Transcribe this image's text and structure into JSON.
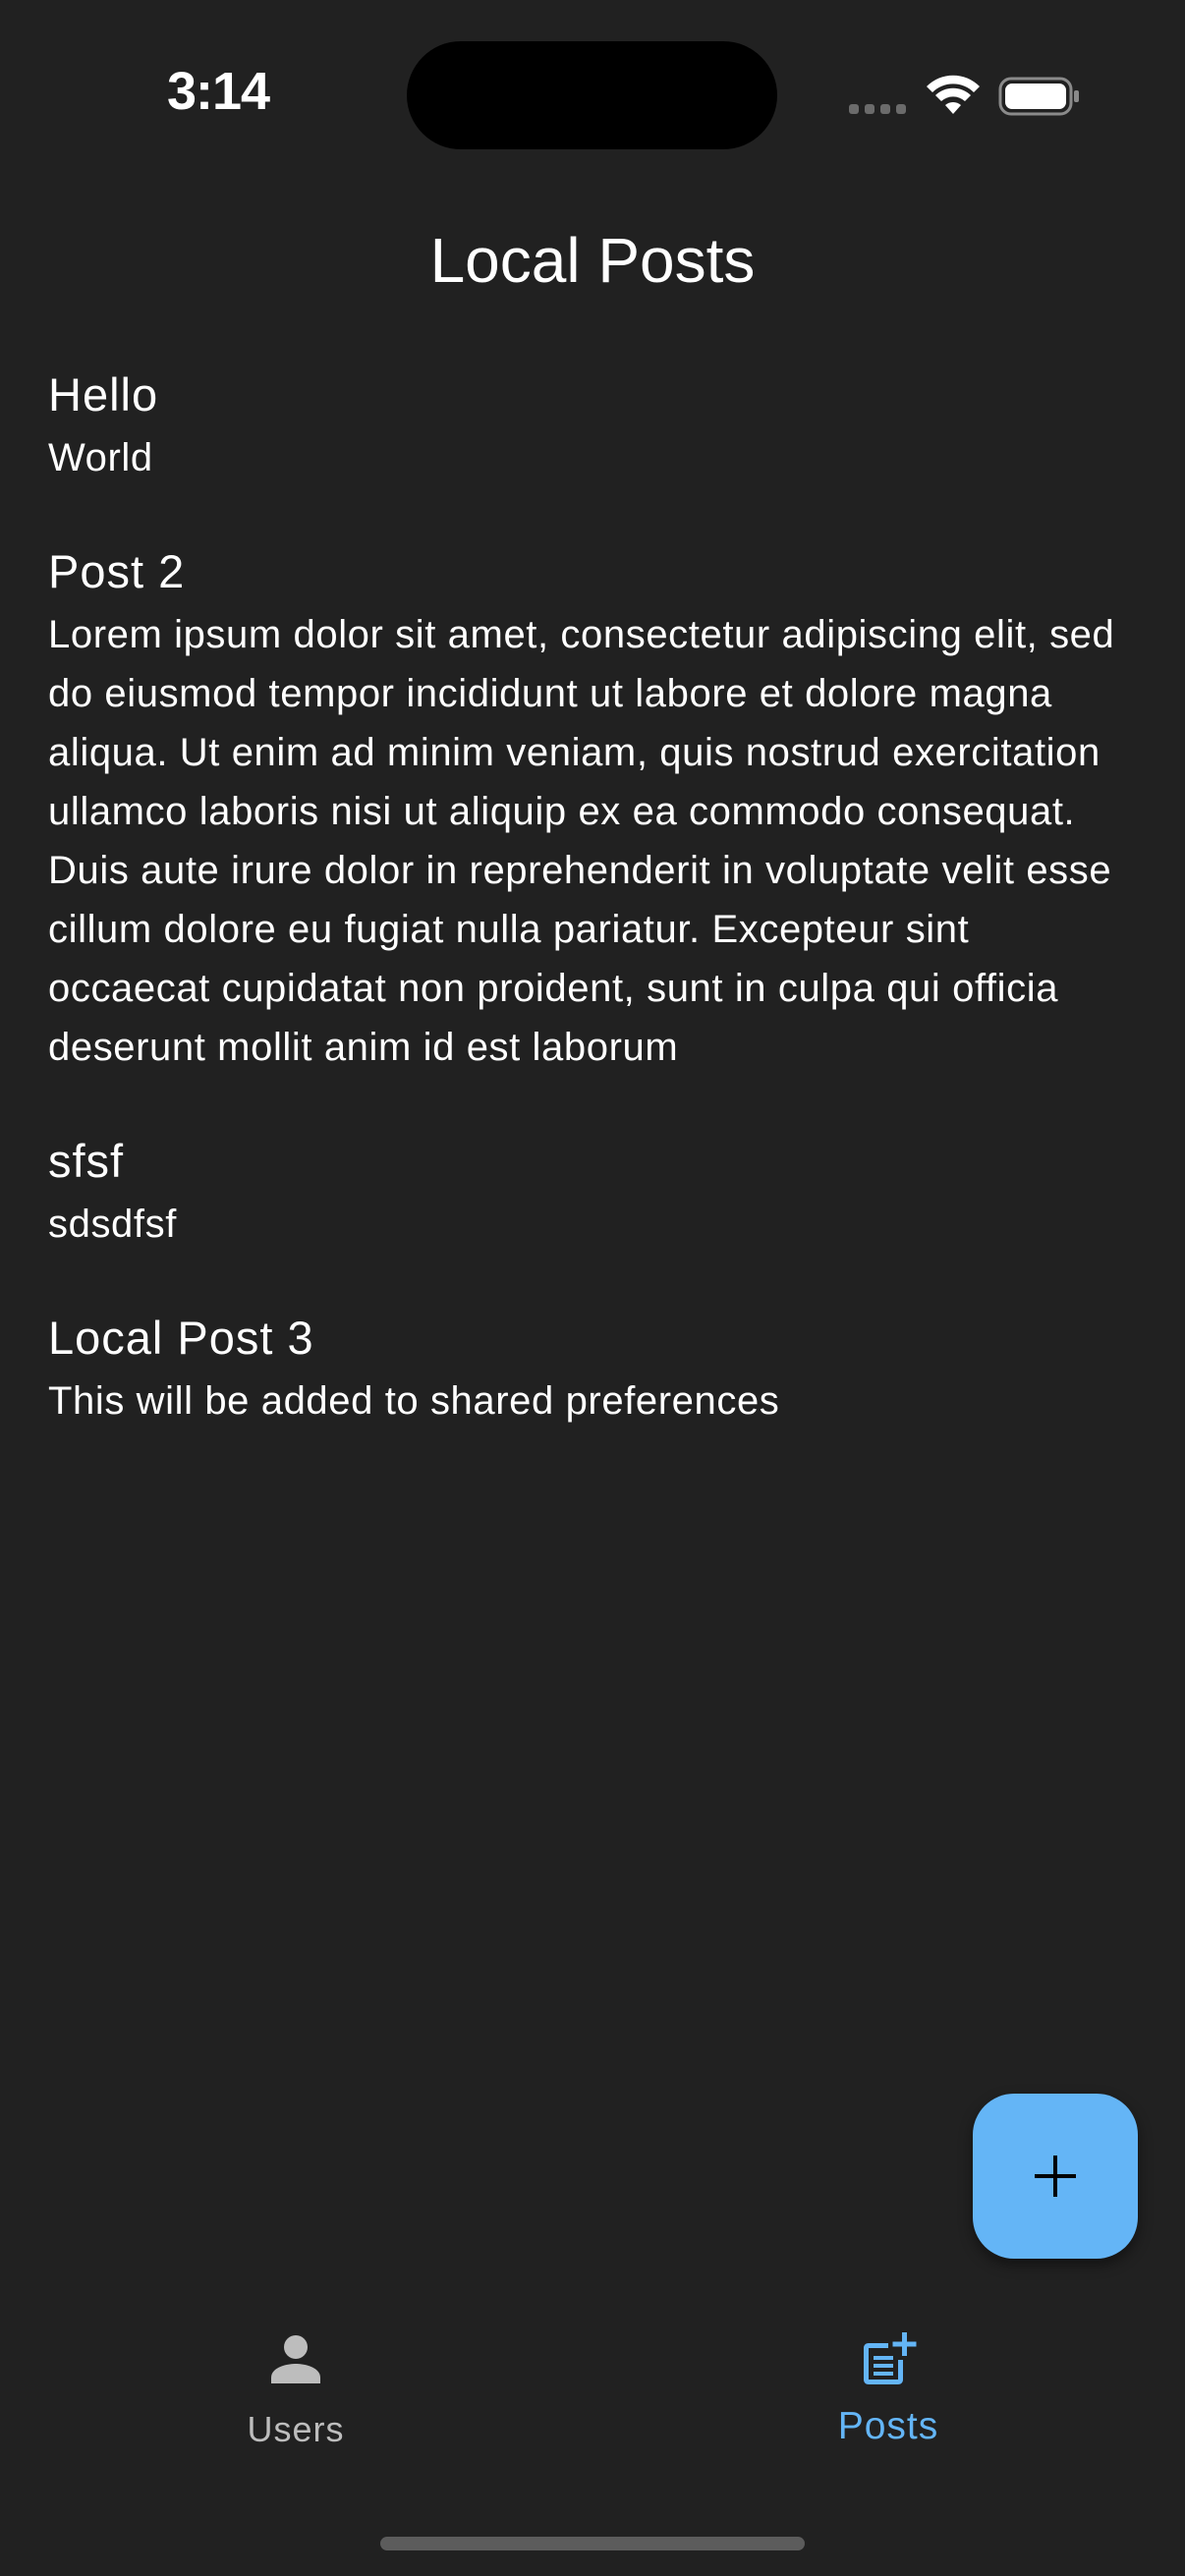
{
  "status_bar": {
    "time": "3:14"
  },
  "app_bar": {
    "title": "Local Posts"
  },
  "posts": [
    {
      "title": "Hello",
      "body": "World"
    },
    {
      "title": "Post 2",
      "body": "Lorem ipsum dolor sit amet, consectetur adipiscing elit, sed do eiusmod tempor incididunt ut labore et dolore magna aliqua. Ut enim ad minim veniam, quis nostrud exercitation ullamco laboris nisi ut aliquip ex ea commodo consequat. Duis aute irure dolor in reprehenderit in voluptate velit esse cillum dolore eu fugiat nulla pariatur. Excepteur sint occaecat cupidatat non proident, sunt in culpa qui officia deserunt mollit anim id est laborum"
    },
    {
      "title": "sfsf",
      "body": "sdsdfsf"
    },
    {
      "title": "Local Post 3",
      "body": "This will be added to shared preferences"
    }
  ],
  "fab": {
    "icon": "plus-icon"
  },
  "bottom_nav": {
    "items": [
      {
        "label": "Users",
        "icon": "person-icon",
        "selected": false
      },
      {
        "label": "Posts",
        "icon": "post-add-icon",
        "selected": true
      }
    ]
  },
  "colors": {
    "background": "#212121",
    "accent": "#64b5f6",
    "text": "#ffffff",
    "inactive": "#bdbdbd"
  }
}
